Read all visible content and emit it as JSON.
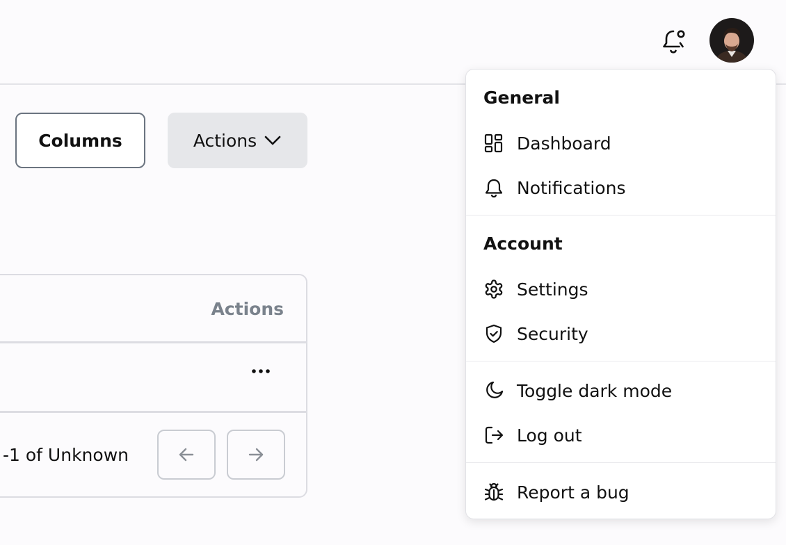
{
  "toolbar": {
    "columns_label": "Columns",
    "actions_label": "Actions"
  },
  "table": {
    "header_actions": "Actions",
    "row_more_label": "...",
    "pagination_text": "-1 of Unknown"
  },
  "menu": {
    "sections": {
      "general": "General",
      "account": "Account"
    },
    "items": {
      "dashboard": "Dashboard",
      "notifications": "Notifications",
      "settings": "Settings",
      "security": "Security",
      "toggle_dark_mode": "Toggle dark mode",
      "log_out": "Log out",
      "report_bug": "Report a bug"
    }
  },
  "icons": {
    "header_bell": "bell-with-dot-icon",
    "dashboard": "layout-grid-icon",
    "notifications": "bell-icon",
    "settings": "gear-icon",
    "security": "shield-check-icon",
    "dark_mode": "moon-icon",
    "log_out": "logout-icon",
    "bug": "bug-icon"
  },
  "colors": {
    "background": "#fcfbfd",
    "actions_button_bg": "#e6e7ea",
    "muted_text": "#7a828c",
    "border": "#dcdce2"
  }
}
